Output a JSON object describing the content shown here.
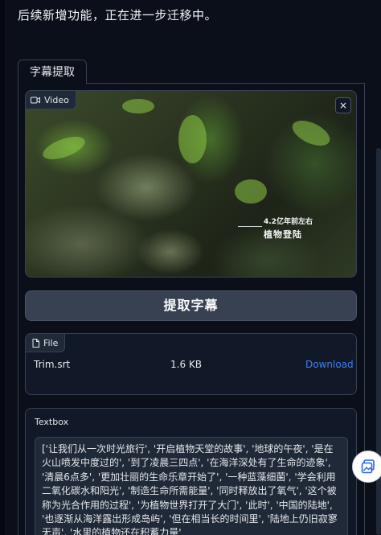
{
  "notice": "后续新增功能，正在进一步迁移中。",
  "tabs": [
    {
      "label": "字幕提取"
    }
  ],
  "video": {
    "label": "Video",
    "close_symbol": "×",
    "overlay_caption_top": "4.2亿年前左右",
    "overlay_caption_main": "植物登陆"
  },
  "extract_button": {
    "label": "提取字幕"
  },
  "file": {
    "label": "File",
    "name": "Trim.srt",
    "size": "1.6 KB",
    "download_label": "Download"
  },
  "textbox": {
    "label": "Textbox",
    "value": "['让我们从一次时光旅行', '开启植物天堂的故事', '地球的午夜', '是在火山喷发中度过的', '到了凌晨三四点', '在海洋深处有了生命的迹象', '清晨6点多', '更加壮丽的生命乐章开始了', '一种蓝藻细菌', '学会利用二氧化碳水和阳光', '制造生命所需能量', '同时释放出了氧气', '这个被称为光合作用的过程', '为植物世界打开了大门', '此时', '中国的陆地', '也逐渐从海洋露出形成岛屿', '但在相当长的时间里', '陆地上仍旧寂寥无声', '水里的植物还在积蓄力量'"
  },
  "icons": {
    "video": "video-camera-icon",
    "file": "file-icon",
    "fab": "image-gallery-icon"
  }
}
